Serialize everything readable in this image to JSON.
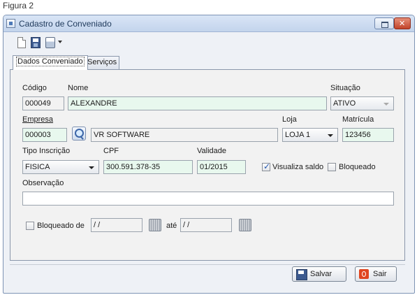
{
  "figure_caption": "Figura 2",
  "window": {
    "title": "Cadastro de Conveniado"
  },
  "tabs": [
    {
      "label": "Dados Conveniado",
      "active": true
    },
    {
      "label": "Serviços",
      "active": false
    }
  ],
  "form": {
    "codigo": {
      "label": "Código",
      "value": "000049"
    },
    "nome": {
      "label": "Nome",
      "value": "ALEXANDRE"
    },
    "situacao": {
      "label": "Situação",
      "value": "ATIVO"
    },
    "empresa": {
      "label": "Empresa",
      "code": "000003",
      "name": "VR SOFTWARE"
    },
    "loja": {
      "label": "Loja",
      "value": "LOJA 1"
    },
    "matricula": {
      "label": "Matrícula",
      "value": "123456"
    },
    "tipo_inscricao": {
      "label": "Tipo Inscrição",
      "value": "FISICA"
    },
    "cpf": {
      "label": "CPF",
      "value": "300.591.378-35"
    },
    "validade": {
      "label": "Validade",
      "value": "01/2015"
    },
    "visualiza_saldo": {
      "label": "Visualiza saldo",
      "checked": true
    },
    "bloqueado": {
      "label": "Bloqueado",
      "checked": false
    },
    "observacao": {
      "label": "Observação",
      "value": ""
    },
    "bloqueado_de": {
      "label": "Bloqueado de",
      "checked": false,
      "from": " /  /",
      "until_label": "até",
      "to": " /  /"
    }
  },
  "buttons": {
    "salvar": "Salvar",
    "sair": "Sair"
  },
  "colors": {
    "required_field": "#e8f8ee",
    "titlebar": "#c3d4ec",
    "close_button": "#c2432a"
  }
}
